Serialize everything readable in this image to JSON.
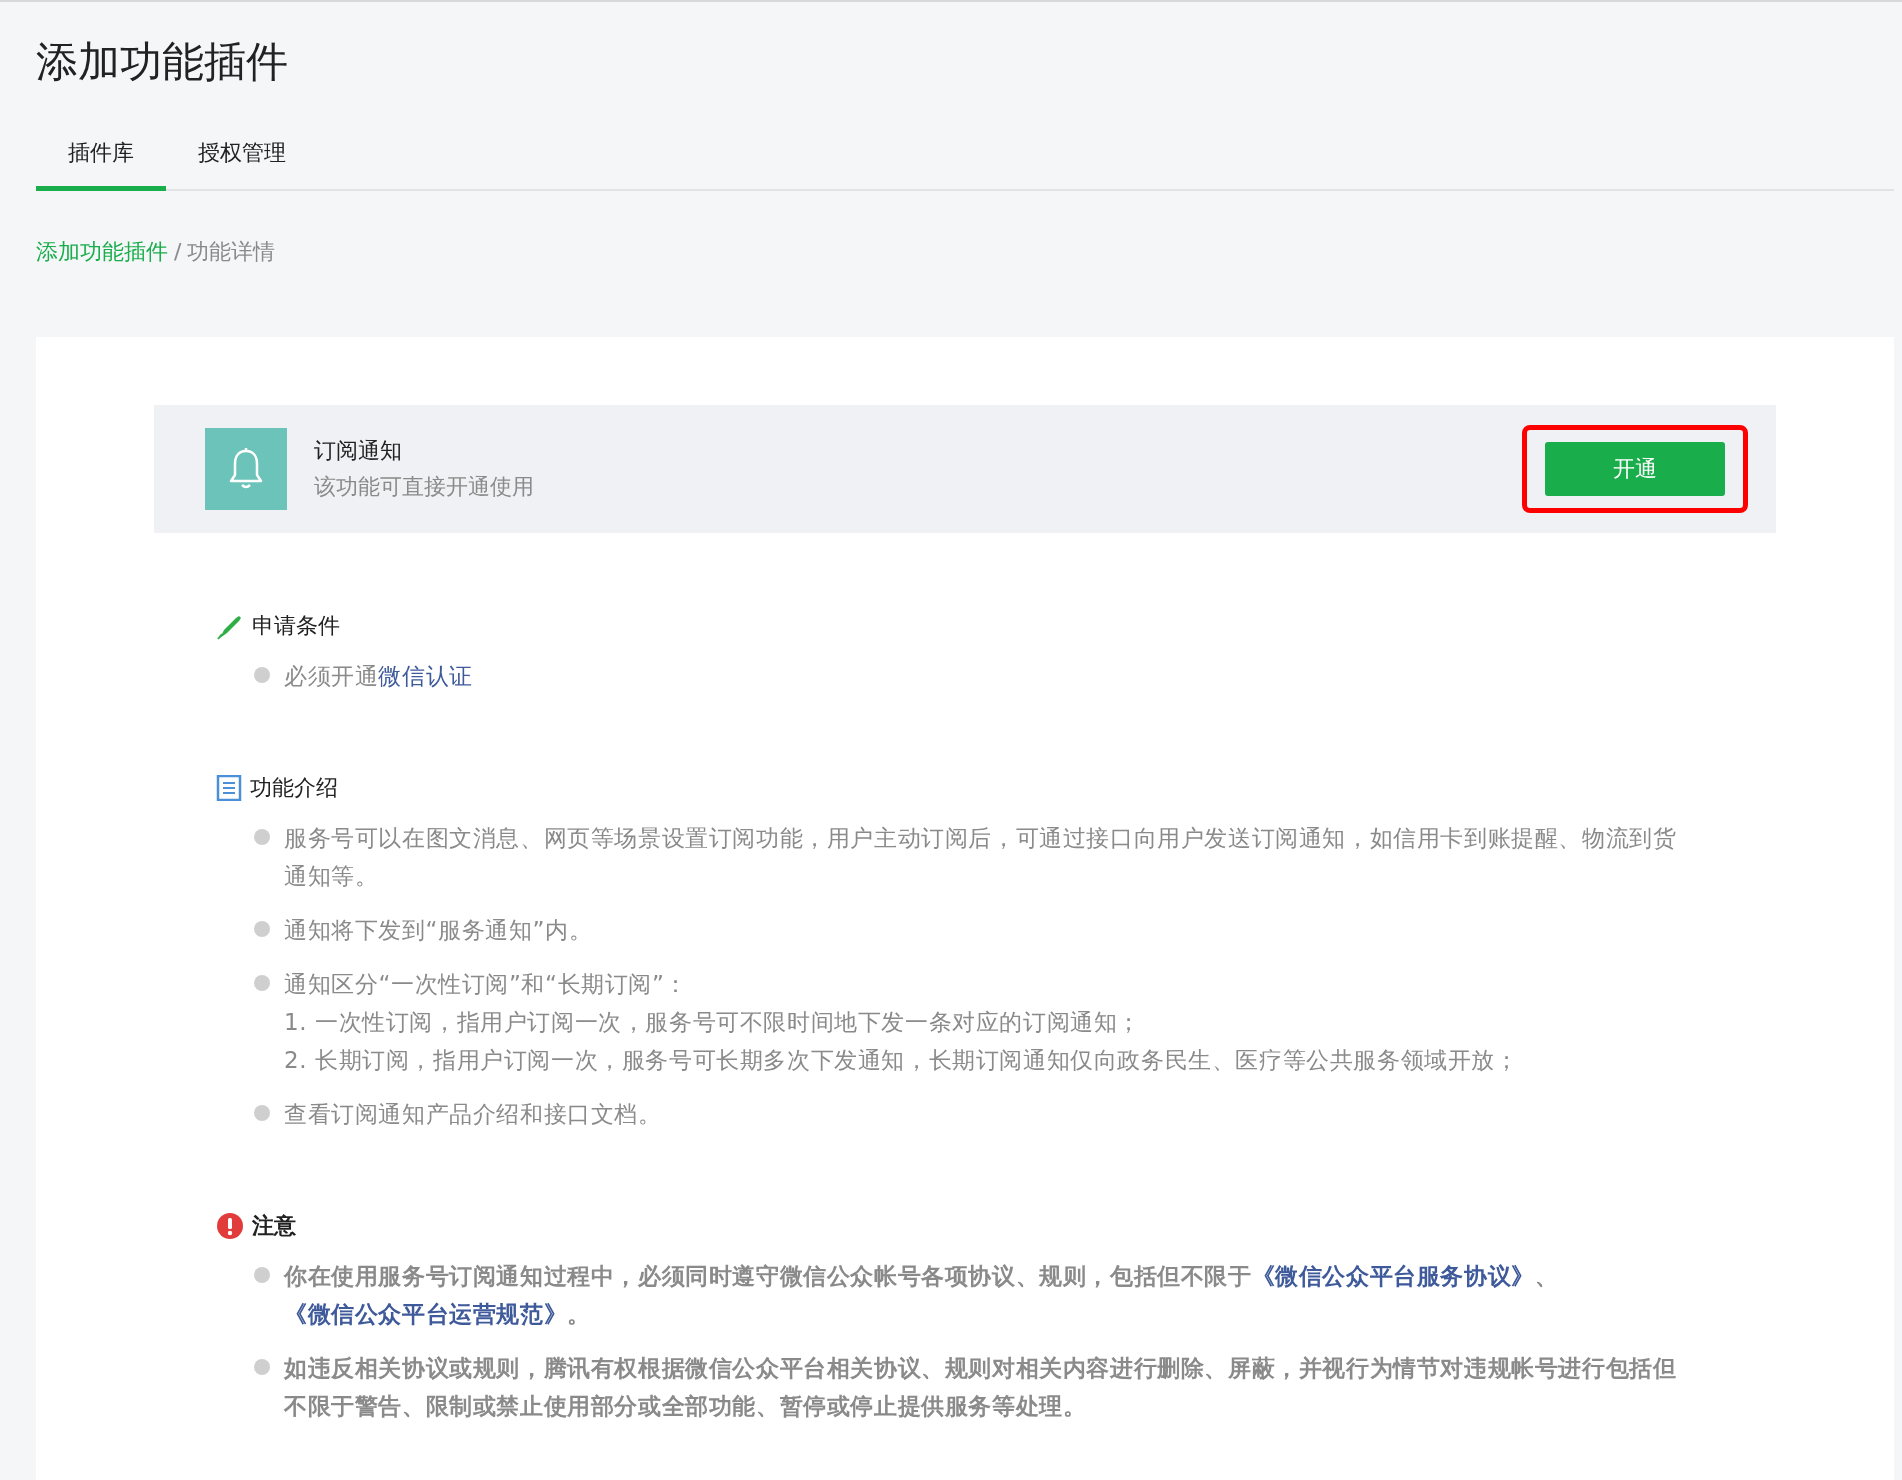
{
  "page": {
    "title": "添加功能插件"
  },
  "tabs": [
    {
      "label": "插件库",
      "selected": true
    },
    {
      "label": "授权管理",
      "selected": false
    }
  ],
  "breadcrumb_separator": "/",
  "breadcrumb": [
    {
      "label": "添加功能插件",
      "link": true
    },
    {
      "label": "功能详情",
      "link": false
    }
  ],
  "plugin": {
    "name": "订阅通知",
    "description": "该功能可直接开通使用",
    "button": "开通",
    "highlighted": true
  },
  "sections": [
    {
      "kind": "pen",
      "title": "申请条件",
      "bold": false,
      "items": [
        {
          "segments": [
            {
              "text": "必须开通",
              "link": false
            },
            {
              "text": "微信认证",
              "link": true
            }
          ]
        }
      ]
    },
    {
      "kind": "doc",
      "title": "功能介绍",
      "bold": false,
      "items": [
        {
          "segments": [
            {
              "text": "服务号可以在图文消息、网页等场景设置订阅功能，用户主动订阅后，可通过接口向用户发送订阅通知，如信用卡到账提醒、物流到货通知等。",
              "link": false
            }
          ]
        },
        {
          "segments": [
            {
              "text": "通知将下发到“服务通知”内。",
              "link": false
            }
          ]
        },
        {
          "segments": [
            {
              "text": "通知区分“一次性订阅”和“长期订阅”：",
              "link": false
            }
          ],
          "lines": [
            "1. 一次性订阅，指用户订阅一次，服务号可不限时间地下发一条对应的订阅通知；",
            "2. 长期订阅，指用户订阅一次，服务号可长期多次下发通知，长期订阅通知仅向政务民生、医疗等公共服务领域开放；"
          ]
        },
        {
          "segments": [
            {
              "text": "查看订阅通知产品介绍和接口文档。",
              "link": false
            }
          ]
        }
      ]
    },
    {
      "kind": "alert",
      "title": "注意",
      "bold": true,
      "items": [
        {
          "segments": [
            {
              "text": "你在使用服务号订阅通知过程中，必须同时遵守微信公众帐号各项协议、规则，包括但不限于",
              "link": false
            },
            {
              "text": "《微信公众平台服务协议》",
              "link": true
            },
            {
              "text": "、",
              "link": false
            },
            {
              "text": "《微信公众平台运营规范》",
              "link": true
            },
            {
              "text": "。",
              "link": false
            }
          ]
        },
        {
          "segments": [
            {
              "text": "如违反相关协议或规则，腾讯有权根据微信公众平台相关协议、规则对相关内容进行删除、屏蔽，并视行为情节对违规帐号进行包括但不限于警告、限制或禁止使用部分或全部功能、暂停或停止提供服务等处理。",
              "link": false
            }
          ]
        }
      ]
    }
  ]
}
